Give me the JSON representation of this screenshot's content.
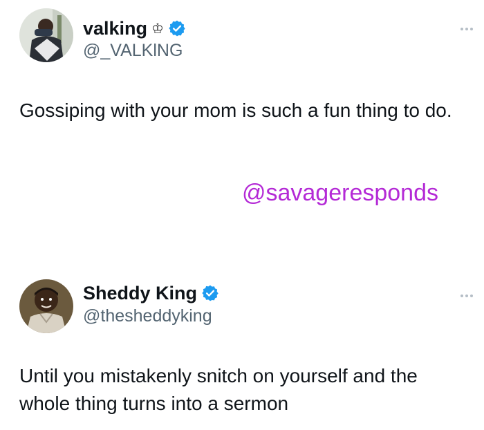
{
  "tweets": [
    {
      "display_name": "valking",
      "name_emoji": "♔",
      "handle": "@_VALKlNG",
      "verified": true,
      "text": "Gossiping with your mom is such a fun thing to do."
    },
    {
      "display_name": "Sheddy King",
      "handle": "@thesheddyking",
      "verified": true,
      "text": "Until you mistakenly snitch on yourself and the whole thing turns into a sermon"
    }
  ],
  "watermark": "@savageresponds",
  "colors": {
    "verified_blue": "#1d9bf0",
    "watermark_purple": "#b42ad6",
    "handle_gray": "#536471"
  },
  "icons": {
    "verified": "verified-badge-icon",
    "more": "more-options-icon",
    "crown": "crown-icon"
  }
}
